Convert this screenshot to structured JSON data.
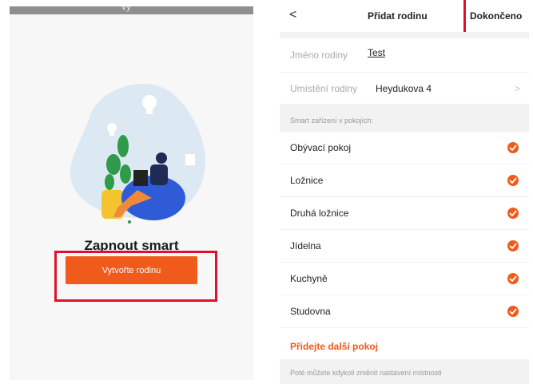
{
  "left": {
    "statusbar_text": "vy",
    "headline": "Zapnout smart",
    "create_button": "Vytvořte rodinu"
  },
  "right": {
    "header": {
      "back_glyph": "<",
      "title": "Přidat rodinu",
      "done": "Dokončeno"
    },
    "family_name": {
      "label": "Jméno rodiny",
      "value": "Test"
    },
    "family_location": {
      "label": "Umístění rodiny",
      "value": "Heydukova 4",
      "chevron": ">"
    },
    "rooms_caption": "Smart zařízení v pokojích:",
    "rooms": [
      {
        "label": "Obývací pokoj",
        "checked": true
      },
      {
        "label": "Ložnice",
        "checked": true
      },
      {
        "label": "Druhá ložnice",
        "checked": true
      },
      {
        "label": "Jídelna",
        "checked": true
      },
      {
        "label": "Kuchyně",
        "checked": true
      },
      {
        "label": "Studovna",
        "checked": true
      }
    ],
    "add_room": "Přidejte další pokoj",
    "footer_note": "Poté můžete kdykoli změnit nastavení místnosti"
  },
  "colors": {
    "accent": "#f05a1a",
    "highlight": "#e0102a",
    "illustration_blob": "#dce8f2",
    "beanbag": "#2f5bd6",
    "plant": "#2f9a4a"
  },
  "icons": [
    "back-arrow-icon",
    "chevron-right-icon",
    "check-circle-icon",
    "light-bulb-icon"
  ]
}
